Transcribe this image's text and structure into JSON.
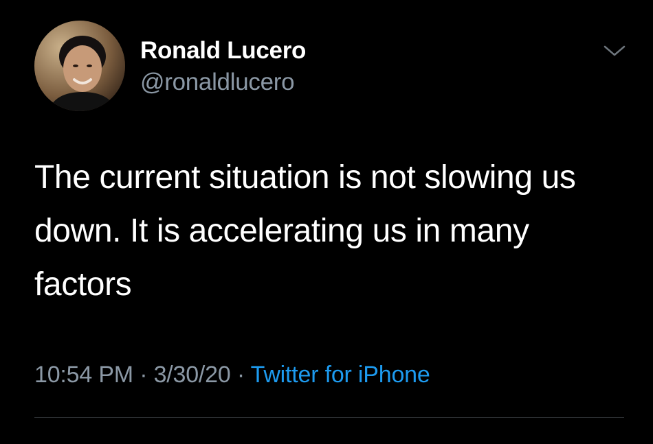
{
  "author": {
    "name": "Ronald Lucero",
    "handle": "@ronaldlucero"
  },
  "tweet": {
    "text": "The current situation is not slowing us down. It is accelerating us in many factors"
  },
  "meta": {
    "time": "10:54 PM",
    "separator": "·",
    "date": "3/30/20",
    "source": "Twitter for iPhone"
  },
  "icons": {
    "more": "chevron-down-icon"
  },
  "colors": {
    "background": "#000000",
    "primary_text": "#ffffff",
    "secondary_text": "#8b98a5",
    "link": "#1d9bf0",
    "divider": "#2f3336"
  }
}
